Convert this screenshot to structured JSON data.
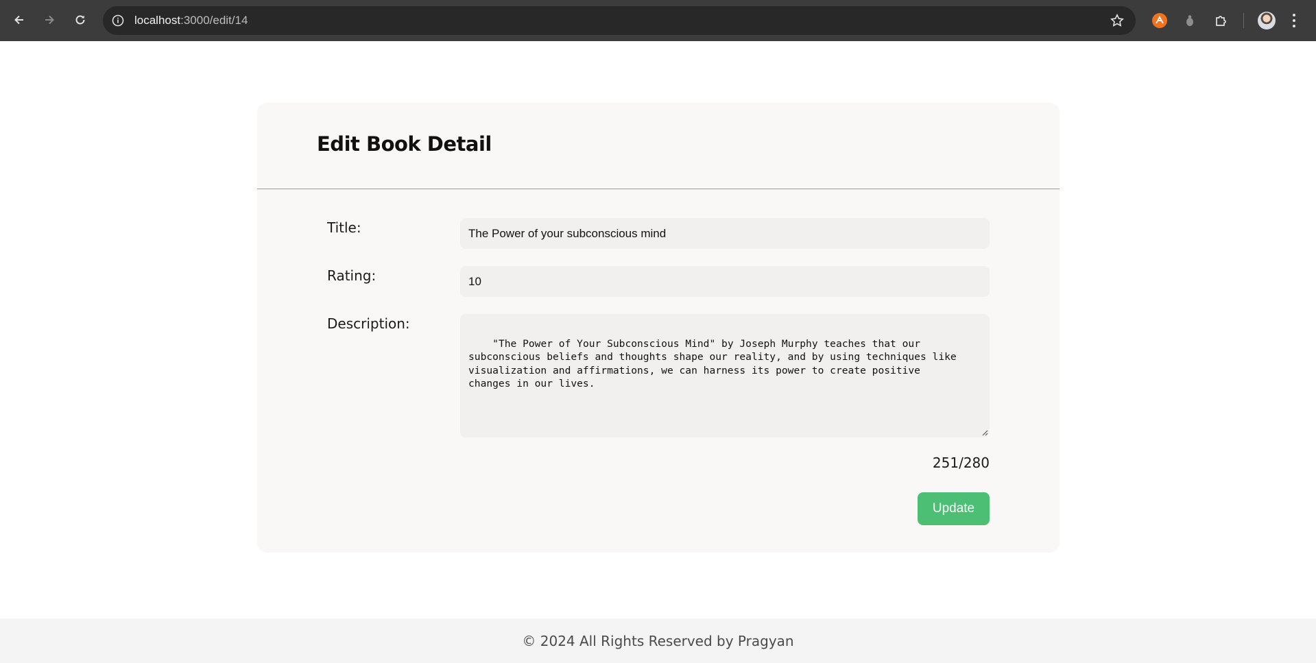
{
  "browser": {
    "url_host": "localhost",
    "url_path": ":3000/edit/14",
    "icons": [
      "back-arrow-icon",
      "forward-arrow-icon",
      "reload-icon",
      "info-icon",
      "star-icon",
      "extension-orange-icon",
      "extension-gray-icon",
      "puzzle-icon",
      "avatar",
      "kebab-menu-icon"
    ]
  },
  "page": {
    "title": "Edit Book Detail",
    "form": {
      "title_label": "Title:",
      "title_value": "The Power of your subconscious mind",
      "rating_label": "Rating:",
      "rating_value": "10",
      "description_label": "Description:",
      "description_value": "\"The Power of Your Subconscious Mind\" by Joseph Murphy teaches that our\nsubconscious beliefs and thoughts shape our reality, and by using techniques like\nvisualization and affirmations, we can harness its power to create positive\nchanges in our lives.",
      "char_count": "251/280",
      "update_label": "Update"
    }
  },
  "footer": {
    "text": "© 2024 All Rights Reserved by Pragyan"
  },
  "colors": {
    "accent_green": "#4cbf74",
    "card_bg": "#f9f8f6",
    "chrome_bg": "#3c3c3c"
  }
}
